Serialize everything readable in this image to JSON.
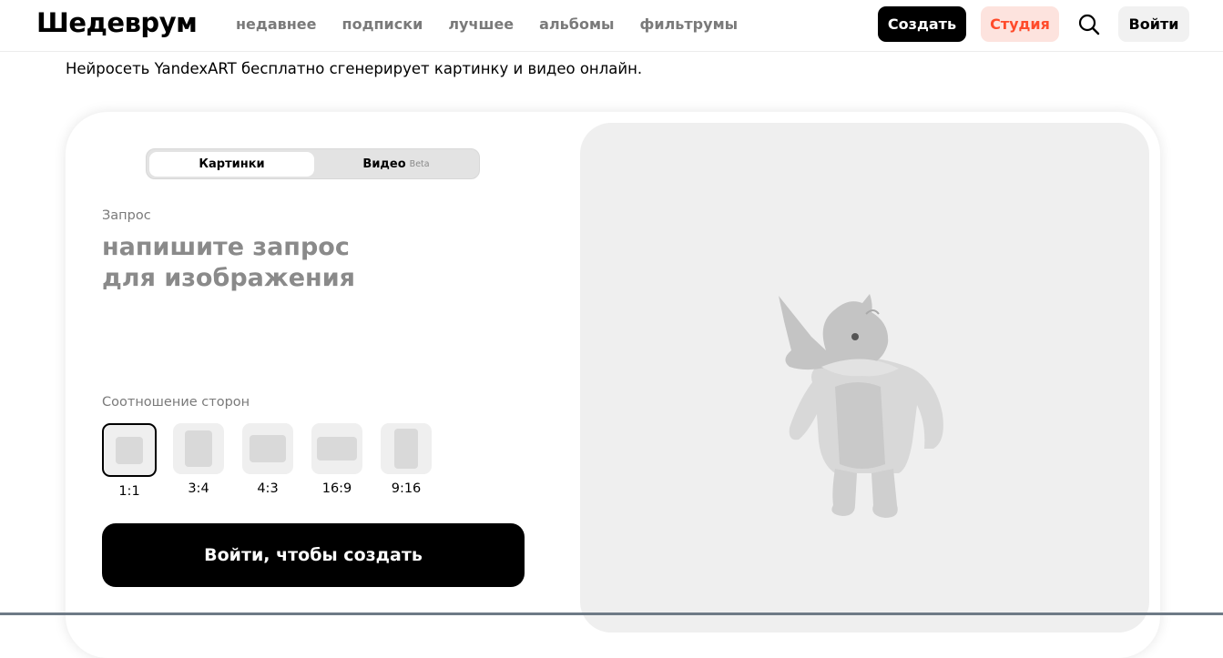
{
  "header": {
    "logo": "Шедеврум",
    "nav": [
      "недавнее",
      "подписки",
      "лучшее",
      "альбомы",
      "фильтрумы"
    ],
    "create_label": "Создать",
    "studio_label": "Студия",
    "login_label": "Войти",
    "search_icon": "search-icon"
  },
  "subtitle": "Нейросеть YandexART бесплатно сгенерирует картинку и видео онлайн.",
  "generator": {
    "tabs": [
      {
        "label": "Картинки",
        "active": true
      },
      {
        "label": "Видео",
        "badge": "Beta",
        "active": false
      }
    ],
    "request_label": "Запрос",
    "prompt_placeholder_line1": "напишите запрос",
    "prompt_placeholder_line2": "для изображения",
    "ratio_label": "Соотношение сторон",
    "ratios": [
      "1:1",
      "3:4",
      "4:3",
      "16:9",
      "9:16"
    ],
    "selected_ratio": "1:1",
    "submit_label": "Войти, чтобы создать"
  },
  "colors": {
    "accent_dark": "#000000",
    "studio_bg": "#fde3de",
    "studio_text": "#ff4b2b",
    "preview_bg": "#efefef"
  }
}
